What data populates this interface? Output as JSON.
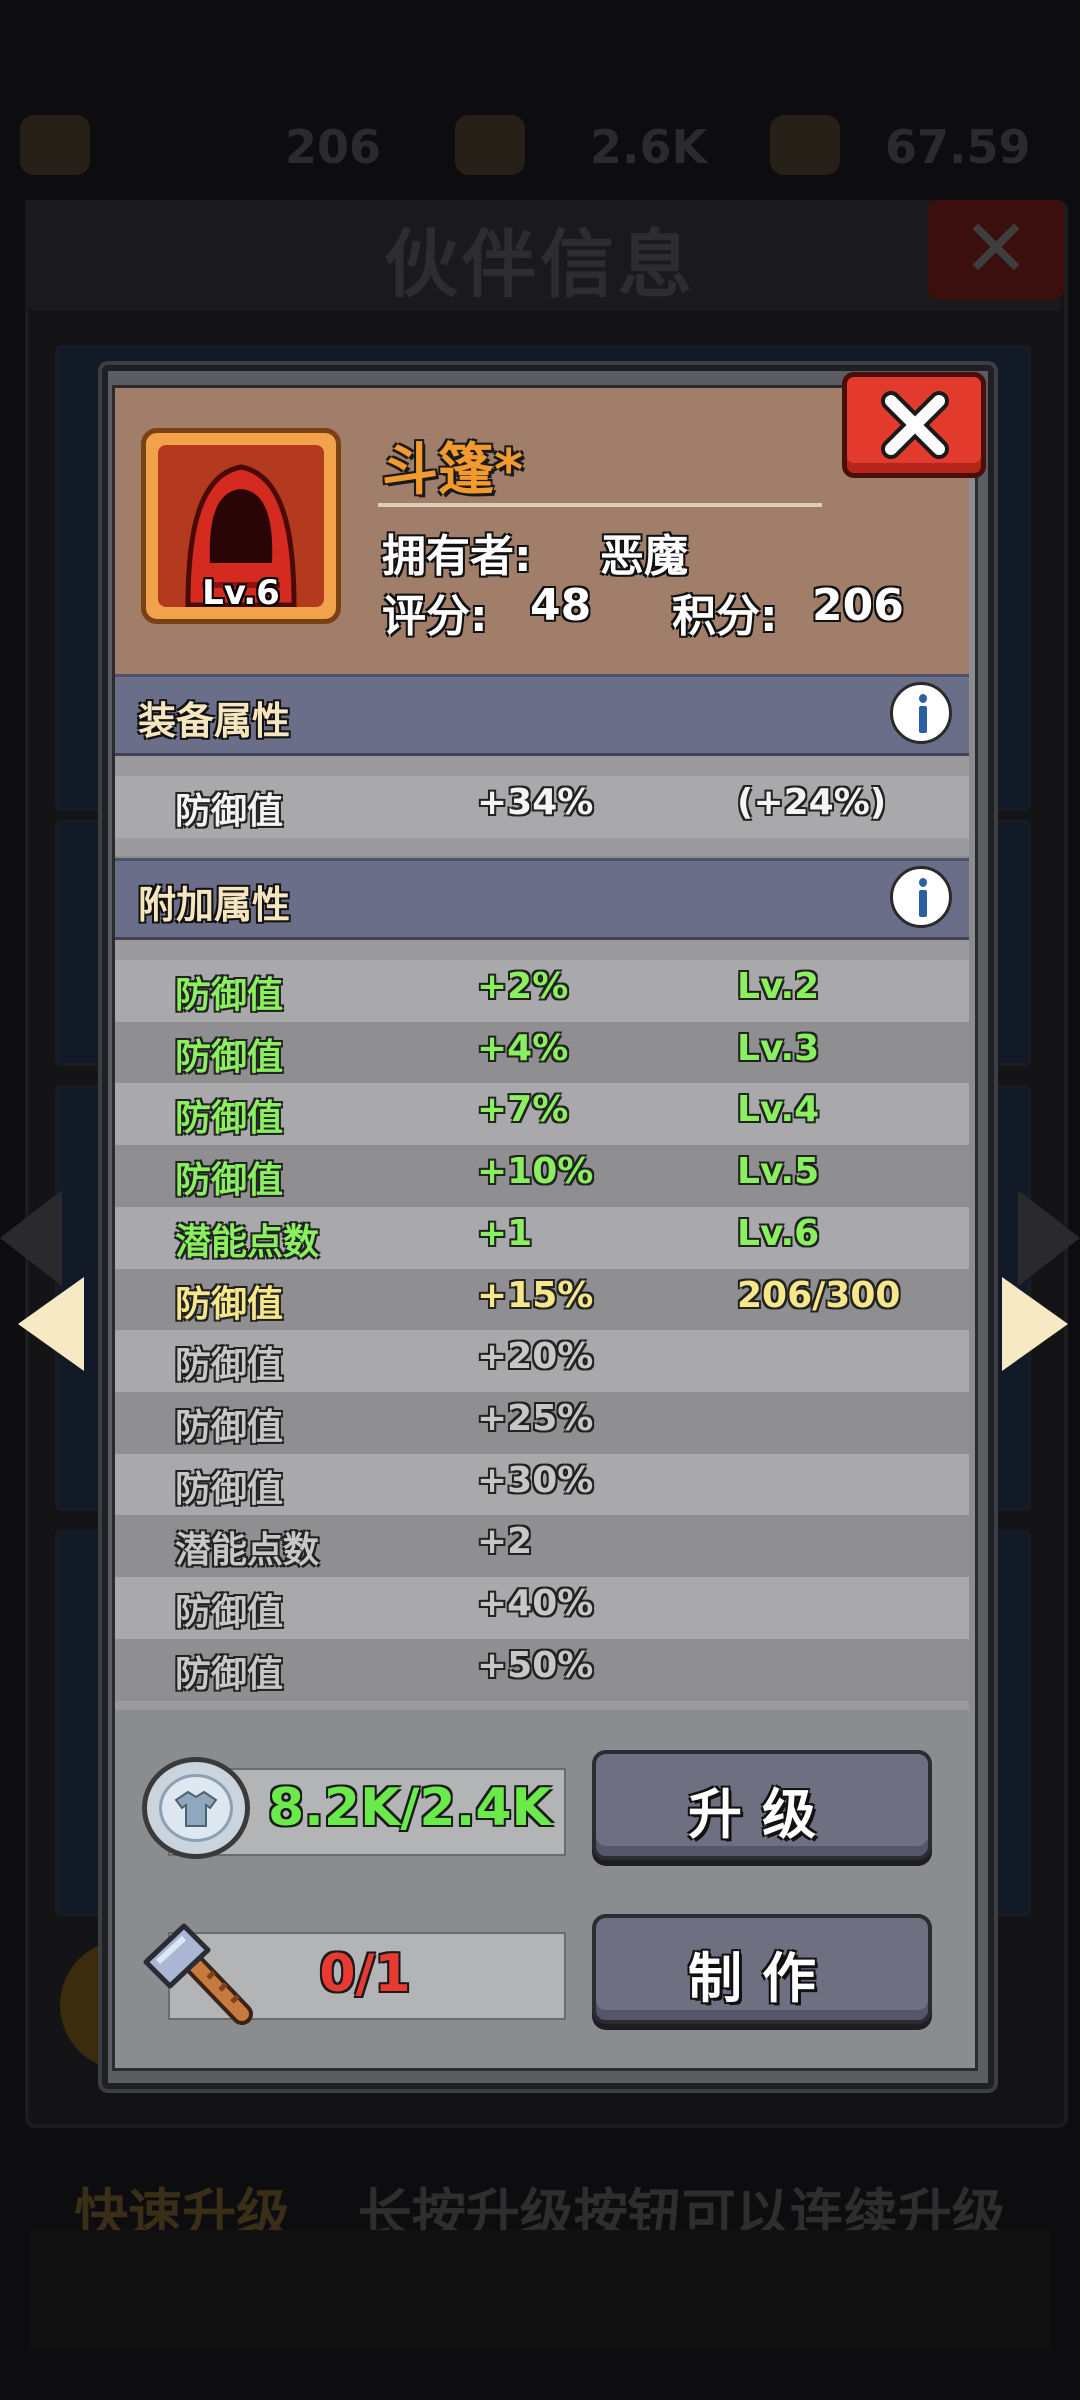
{
  "background": {
    "resources": [
      "206",
      "2.6K",
      "67.59"
    ],
    "title": "伙伴信息",
    "hint_highlight": "快速升级",
    "hint_text": "长按升级按钮可以连续升级"
  },
  "item": {
    "name": "斗篷*",
    "level_badge": "Lv.6",
    "owner_label": "拥有者:",
    "owner_value": "恶魔",
    "score_label": "评分:",
    "score_value": "48",
    "points_label": "积分:",
    "points_value": "206"
  },
  "equip_section": {
    "title": "装备属性",
    "rows": [
      {
        "name": "防御值",
        "value": "+34%",
        "extra": "(+24%)"
      }
    ]
  },
  "bonus_section": {
    "title": "附加属性",
    "rows": [
      {
        "name": "防御值",
        "value": "+2%",
        "extra": "Lv.2",
        "state": "unlocked"
      },
      {
        "name": "防御值",
        "value": "+4%",
        "extra": "Lv.3",
        "state": "unlocked"
      },
      {
        "name": "防御值",
        "value": "+7%",
        "extra": "Lv.4",
        "state": "unlocked"
      },
      {
        "name": "防御值",
        "value": "+10%",
        "extra": "Lv.5",
        "state": "unlocked"
      },
      {
        "name": "潜能点数",
        "value": "+1",
        "extra": "Lv.6",
        "state": "unlocked"
      },
      {
        "name": "防御值",
        "value": "+15%",
        "extra": "206/300",
        "state": "next"
      },
      {
        "name": "防御值",
        "value": "+20%",
        "extra": "",
        "state": "locked"
      },
      {
        "name": "防御值",
        "value": "+25%",
        "extra": "",
        "state": "locked"
      },
      {
        "name": "防御值",
        "value": "+30%",
        "extra": "",
        "state": "locked"
      },
      {
        "name": "潜能点数",
        "value": "+2",
        "extra": "",
        "state": "locked"
      },
      {
        "name": "防御值",
        "value": "+40%",
        "extra": "",
        "state": "locked"
      },
      {
        "name": "防御值",
        "value": "+50%",
        "extra": "",
        "state": "locked"
      }
    ]
  },
  "upgrade": {
    "cost": "8.2K/2.4K",
    "button_label": "升级"
  },
  "craft": {
    "cost": "0/1",
    "button_label": "制作"
  },
  "colors": {
    "unlocked": "#8af05f",
    "next": "#f6e88a",
    "locked": "#c7c7c7",
    "item_name": "#f39a2e",
    "close_button": "#e23a2c"
  },
  "icons": {
    "close": "close-x-icon",
    "info": "info-icon",
    "coin": "shirt-coin-icon",
    "hammer": "hammer-icon",
    "prev": "arrow-left-icon",
    "next": "arrow-right-icon"
  }
}
